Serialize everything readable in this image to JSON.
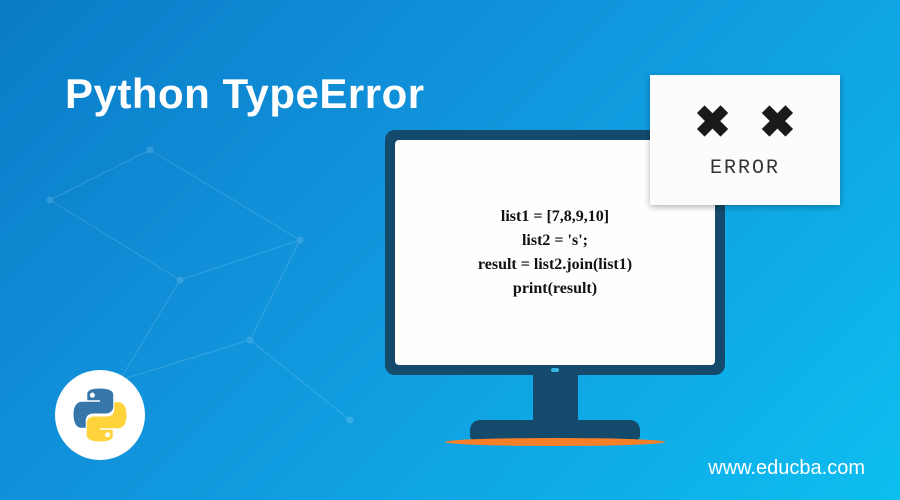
{
  "title": "Python TypeError",
  "code": {
    "line1": "list1 = [7,8,9,10]",
    "line2": "list2 = 's';",
    "line3": "result = list2.join(list1)",
    "line4": "print(result)"
  },
  "error": {
    "x1": "✖",
    "x2": "✖",
    "label": "ERROR"
  },
  "website": "www.educba.com"
}
